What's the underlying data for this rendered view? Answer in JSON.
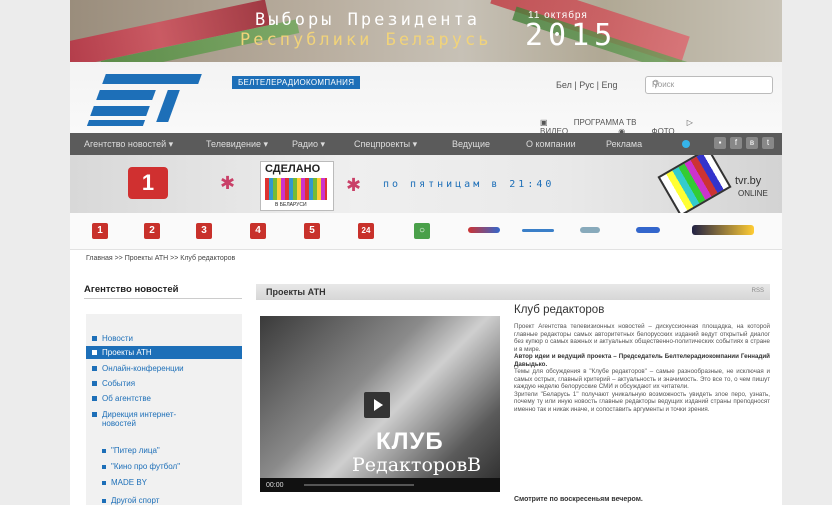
{
  "banner": {
    "line1": "Выборы Президента",
    "line2": "Республики Беларусь",
    "date": "11 октября",
    "year": "2015"
  },
  "header": {
    "company": "БЕЛТЕЛЕРАДИОКОМПАНИЯ",
    "languages": "Бел | Рус | Eng",
    "search_placeholder": "Поиск",
    "media_links": [
      "ПРОГРАММА ТВ",
      "ВИДЕО",
      "ФОТО"
    ]
  },
  "nav": {
    "items": [
      "Агентство новостей",
      "Телевидение",
      "Радио",
      "Спецпроекты",
      "Ведущие",
      "О компании",
      "Реклама"
    ]
  },
  "promo": {
    "sdelano": "СДЕЛАНО",
    "sdelano_sub": "В БЕЛАРУСИ",
    "schedule": "по пятницам в 21:40",
    "tvby": "tvr.by",
    "online": "ONLINE"
  },
  "channels": [
    "1",
    "2",
    "3",
    "4",
    "5",
    "24"
  ],
  "breadcrumb": "Главная  >>  Проекты АТН  >>  Клуб редакторов",
  "sidebar": {
    "heading": "Агентство новостей",
    "items": [
      {
        "label": "Новости",
        "active": false
      },
      {
        "label": "Проекты АТН",
        "active": true
      },
      {
        "label": "Онлайн-конференции",
        "active": false
      },
      {
        "label": "События",
        "active": false
      },
      {
        "label": "Об агентстве",
        "active": false
      },
      {
        "label": "Дирекция интернет-",
        "active": false
      }
    ],
    "item6_line2": "новостей",
    "subitems": [
      "\"Питер лица\"",
      "\"Кино про футбол\"",
      "MADE BY",
      "Другой спорт"
    ]
  },
  "content": {
    "section_title": "Проекты АТН",
    "section_right": "RSS",
    "video_title_1": "КЛУБ",
    "video_title_2": "РедакторовВ",
    "video_time": "00:00",
    "article_title": "Клуб редакторов",
    "paragraph1": "Проект Агентства телевизионных новостей – дискуссионная площадка, на которой главные редакторы самых авторитетных белорусских изданий ведут открытый диалог без купюр о самых важных и актуальных общественно-политических событиях в стране и в мире.",
    "author": "Автор идеи и ведущий проекта – Председатель Белтелерадиокомпании Геннадий Давыдько.",
    "paragraph2": "Темы для обсуждения в \"Клубе редакторов\" – самые разнообразные, не исключая и самых острых, главный критерий – актуальность и значимость. Это все то, о чем пишут каждую неделю белорусские СМИ и обсуждают их читатели.",
    "paragraph3": "Зрители \"Беларусь 1\" получают уникальную возможность увидеть злое перо, узнать, почему ту или иную новость главные редакторы ведущих изданий страны преподносят именно так и никак иначе, и сопоставить аргументы и точки зрения.",
    "bottom": "Смотрите по воскресеньям вечером."
  }
}
